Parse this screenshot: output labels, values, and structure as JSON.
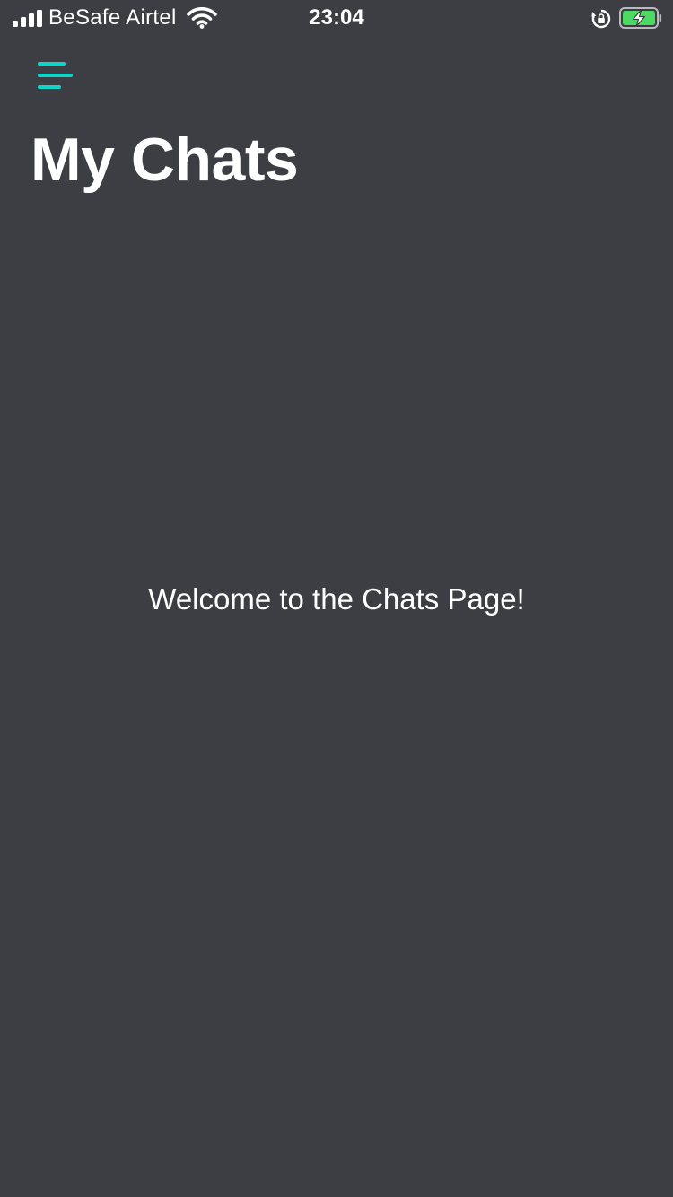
{
  "status_bar": {
    "carrier": "BeSafe Airtel",
    "time": "23:04",
    "signal_bars": 4,
    "battery_charging": true,
    "icons": [
      "signal-icon",
      "wifi-icon",
      "rotation-lock-icon",
      "battery-icon"
    ]
  },
  "header": {
    "menu_icon": "hamburger-menu-icon",
    "title": "My Chats"
  },
  "main": {
    "welcome_text": "Welcome to the Chats Page!"
  },
  "colors": {
    "background": "#3d3e43",
    "accent": "#10d4c8",
    "battery": "#4cd964"
  }
}
